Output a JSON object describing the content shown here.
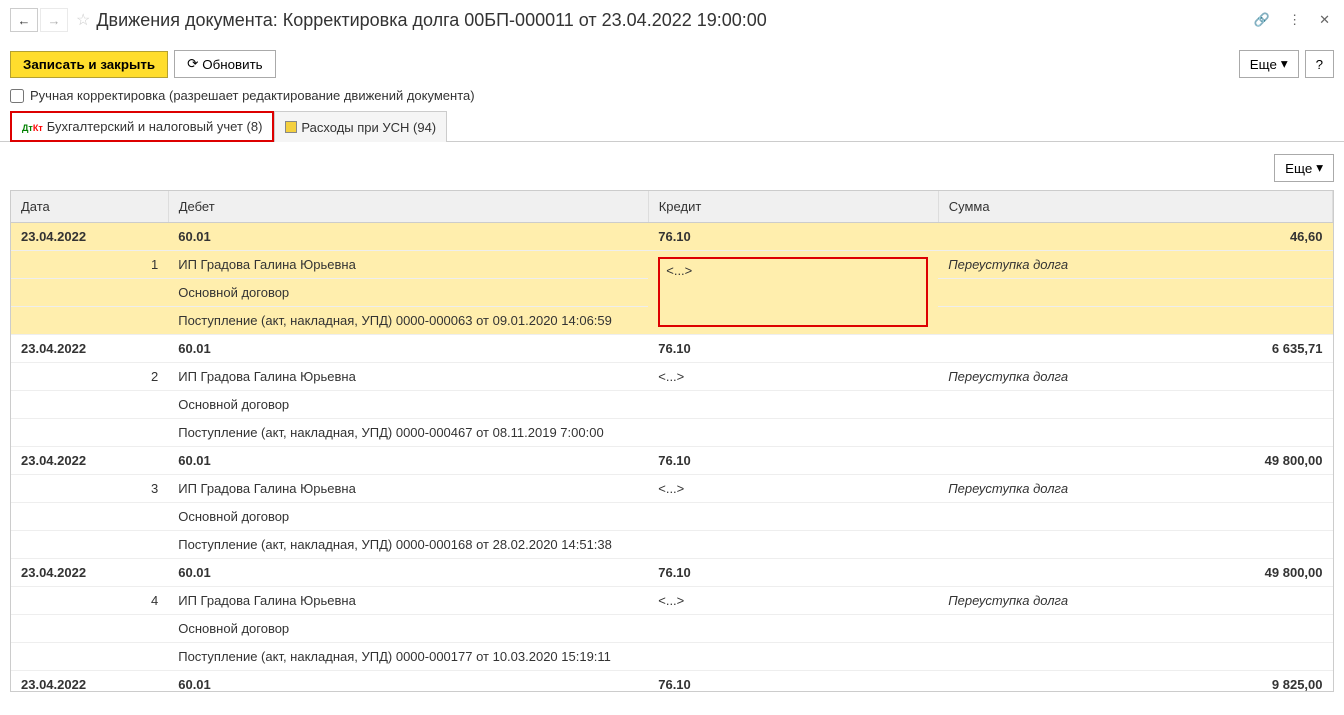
{
  "header": {
    "title": "Движения документа: Корректировка долга 00БП-000011 от 23.04.2022 19:00:00"
  },
  "toolbar": {
    "save_close": "Записать и закрыть",
    "refresh": "Обновить",
    "more": "Еще",
    "help": "?"
  },
  "checkbox": {
    "label": "Ручная корректировка (разрешает редактирование движений документа)"
  },
  "tabs": {
    "tab1": "Бухгалтерский и налоговый учет (8)",
    "tab2": "Расходы при УСН (94)"
  },
  "inner": {
    "more": "Еще"
  },
  "columns": {
    "date": "Дата",
    "debit": "Дебет",
    "credit": "Кредит",
    "sum": "Сумма"
  },
  "entries": [
    {
      "date": "23.04.2022",
      "num": "1",
      "debit_acc": "60.01",
      "credit_acc": "76.10",
      "sum": "46,60",
      "debit_sub1": "ИП Градова Галина Юрьевна",
      "credit_sub1": "<...>",
      "desc": "Переуступка долга",
      "debit_sub2": "Основной договор",
      "debit_sub3": "Поступление (акт, накладная, УПД) 0000-000063 от 09.01.2020 14:06:59"
    },
    {
      "date": "23.04.2022",
      "num": "2",
      "debit_acc": "60.01",
      "credit_acc": "76.10",
      "sum": "6 635,71",
      "debit_sub1": "ИП Градова Галина Юрьевна",
      "credit_sub1": "<...>",
      "desc": "Переуступка долга",
      "debit_sub2": "Основной договор",
      "debit_sub3": "Поступление (акт, накладная, УПД) 0000-000467 от 08.11.2019 7:00:00"
    },
    {
      "date": "23.04.2022",
      "num": "3",
      "debit_acc": "60.01",
      "credit_acc": "76.10",
      "sum": "49 800,00",
      "debit_sub1": "ИП Градова Галина Юрьевна",
      "credit_sub1": "<...>",
      "desc": "Переуступка долга",
      "debit_sub2": "Основной договор",
      "debit_sub3": "Поступление (акт, накладная, УПД) 0000-000168 от 28.02.2020 14:51:38"
    },
    {
      "date": "23.04.2022",
      "num": "4",
      "debit_acc": "60.01",
      "credit_acc": "76.10",
      "sum": "49 800,00",
      "debit_sub1": "ИП Градова Галина Юрьевна",
      "credit_sub1": "<...>",
      "desc": "Переуступка долга",
      "debit_sub2": "Основной договор",
      "debit_sub3": "Поступление (акт, накладная, УПД) 0000-000177 от 10.03.2020 15:19:11"
    },
    {
      "date": "23.04.2022",
      "num": "",
      "debit_acc": "60.01",
      "credit_acc": "76.10",
      "sum": "9 825,00"
    }
  ]
}
